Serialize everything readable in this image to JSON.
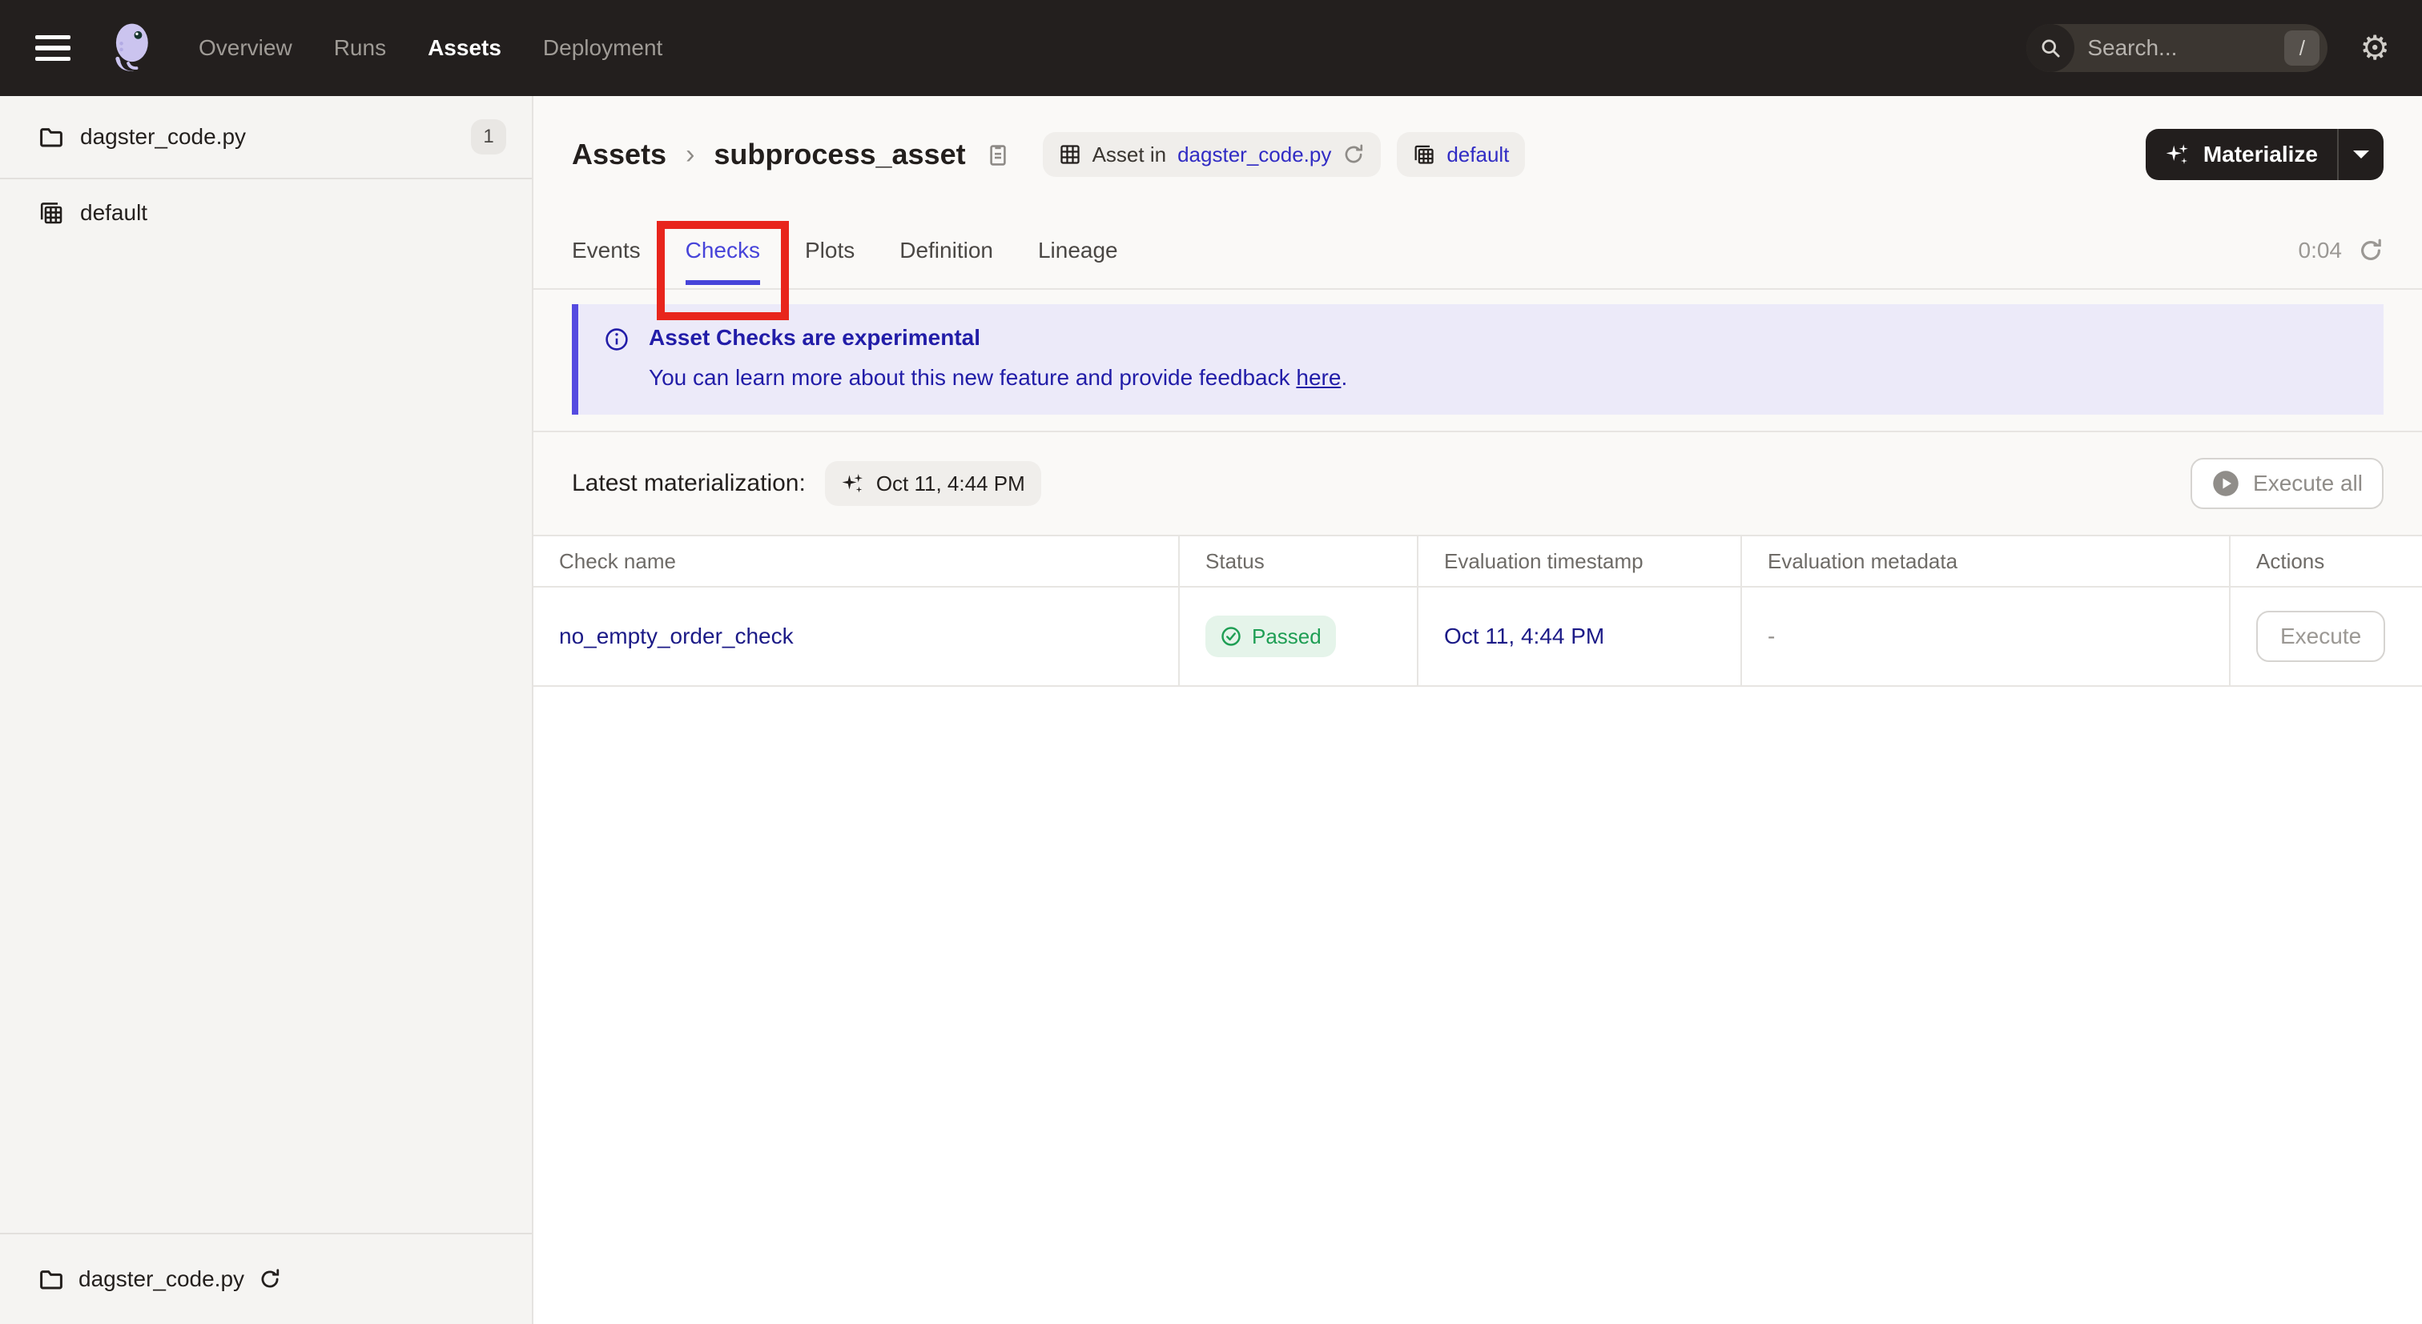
{
  "topnav": {
    "nav_items": [
      {
        "label": "Overview",
        "active": false
      },
      {
        "label": "Runs",
        "active": false
      },
      {
        "label": "Assets",
        "active": true
      },
      {
        "label": "Deployment",
        "active": false
      }
    ],
    "search_placeholder": "Search...",
    "search_shortcut": "/"
  },
  "sidebar": {
    "file_item": {
      "label": "dagster_code.py",
      "count": "1"
    },
    "repo_item": {
      "label": "default"
    },
    "footer_item": {
      "label": "dagster_code.py"
    }
  },
  "header": {
    "breadcrumb_root": "Assets",
    "breadcrumb_separator": "›",
    "asset_name": "subprocess_asset",
    "asset_badge_prefix": "Asset in",
    "asset_badge_link": "dagster_code.py",
    "repo_badge_label": "default",
    "materialize_label": "Materialize"
  },
  "tabs": {
    "items": [
      {
        "label": "Events",
        "active": false
      },
      {
        "label": "Checks",
        "active": true
      },
      {
        "label": "Plots",
        "active": false
      },
      {
        "label": "Definition",
        "active": false
      },
      {
        "label": "Lineage",
        "active": false
      }
    ],
    "timer": "0:04"
  },
  "banner": {
    "title": "Asset Checks are experimental",
    "body_text": "You can learn more about this new feature and provide feedback ",
    "link_text": "here",
    "after_link": "."
  },
  "checks": {
    "latest_label": "Latest materialization:",
    "latest_value": "Oct 11, 4:44 PM",
    "execute_all_label": "Execute all",
    "table": {
      "headers": [
        "Check name",
        "Status",
        "Evaluation timestamp",
        "Evaluation metadata",
        "Actions"
      ],
      "rows": [
        {
          "name": "no_empty_order_check",
          "status": "Passed",
          "timestamp": "Oct 11, 4:44 PM",
          "metadata": "-",
          "action": "Execute"
        }
      ]
    }
  },
  "colors": {
    "topnav_bg": "#231F1E",
    "accent_indigo": "#4744D9",
    "banner_bg": "#ECEAF9",
    "banner_text": "#221DA8",
    "status_passed_green": "#1E9E54",
    "annotation_red": "#E8251C",
    "table_link_navy": "#1C1B87"
  }
}
